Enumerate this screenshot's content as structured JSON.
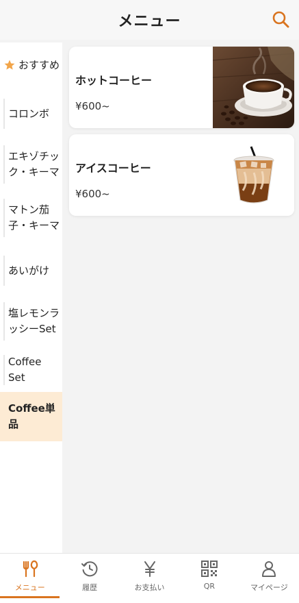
{
  "header": {
    "title": "メニュー",
    "search_icon": "search-icon"
  },
  "accent_color": "#d9741f",
  "sidebar": {
    "items": [
      {
        "label": "おすすめ",
        "icon": "star-icon",
        "favorite": true
      },
      {
        "label": "コロンボ"
      },
      {
        "label": "エキゾチック・キーマ"
      },
      {
        "label": "マトン茄子・キーマ"
      },
      {
        "label": "あいがけ"
      },
      {
        "label": "塩レモンラッシーSet"
      },
      {
        "label": "Coffee Set"
      },
      {
        "label": "Coffee単品",
        "active": true
      }
    ]
  },
  "products": [
    {
      "name": "ホットコーヒー",
      "price": "¥600~",
      "image": "hot-coffee-image"
    },
    {
      "name": "アイスコーヒー",
      "price": "¥600~",
      "image": "iced-coffee-image"
    }
  ],
  "tabbar": {
    "tabs": [
      {
        "label": "メニュー",
        "icon": "utensils-icon",
        "active": true
      },
      {
        "label": "履歴",
        "icon": "history-icon"
      },
      {
        "label": "お支払い",
        "icon": "yen-icon"
      },
      {
        "label": "QR",
        "icon": "qr-code-icon"
      },
      {
        "label": "マイページ",
        "icon": "user-icon"
      }
    ]
  }
}
